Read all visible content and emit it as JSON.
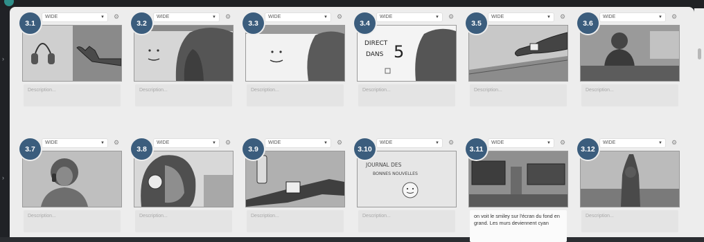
{
  "app": {
    "accent": "#3b5d7d",
    "background": "#ededed"
  },
  "panels": [
    {
      "number": "3.1",
      "shot": "WIDE",
      "description": "",
      "placeholder": "Description..."
    },
    {
      "number": "3.2",
      "shot": "WIDE",
      "description": "",
      "placeholder": "Description..."
    },
    {
      "number": "3.3",
      "shot": "WIDE",
      "description": "",
      "placeholder": "Description..."
    },
    {
      "number": "3.4",
      "shot": "WIDE",
      "description": "",
      "placeholder": "Description...",
      "frame_text": [
        "DIRECT",
        "DANS",
        "5"
      ]
    },
    {
      "number": "3.5",
      "shot": "WIDE",
      "description": "",
      "placeholder": "Description..."
    },
    {
      "number": "3.6",
      "shot": "WIDE",
      "description": "",
      "placeholder": "Description..."
    },
    {
      "number": "3.7",
      "shot": "WIDE",
      "description": "",
      "placeholder": "Description..."
    },
    {
      "number": "3.8",
      "shot": "WIDE",
      "description": "",
      "placeholder": "Description..."
    },
    {
      "number": "3.9",
      "shot": "WIDE",
      "description": "",
      "placeholder": "Description..."
    },
    {
      "number": "3.10",
      "shot": "WIDE",
      "description": "",
      "placeholder": "Description...",
      "frame_text": [
        "JOURNAL DES",
        "BONNES NOUVELLES"
      ]
    },
    {
      "number": "3.11",
      "shot": "WIDE",
      "description": "on voit le smiley sur l'écran du fond en grand. Les murs deviennent cyan",
      "placeholder": "Description..."
    },
    {
      "number": "3.12",
      "shot": "WIDE",
      "description": "",
      "placeholder": "Description..."
    }
  ],
  "icons": {
    "settings": "gear-icon",
    "dropdown": "chevron-down-icon",
    "nav": "chevron-right-icon"
  }
}
